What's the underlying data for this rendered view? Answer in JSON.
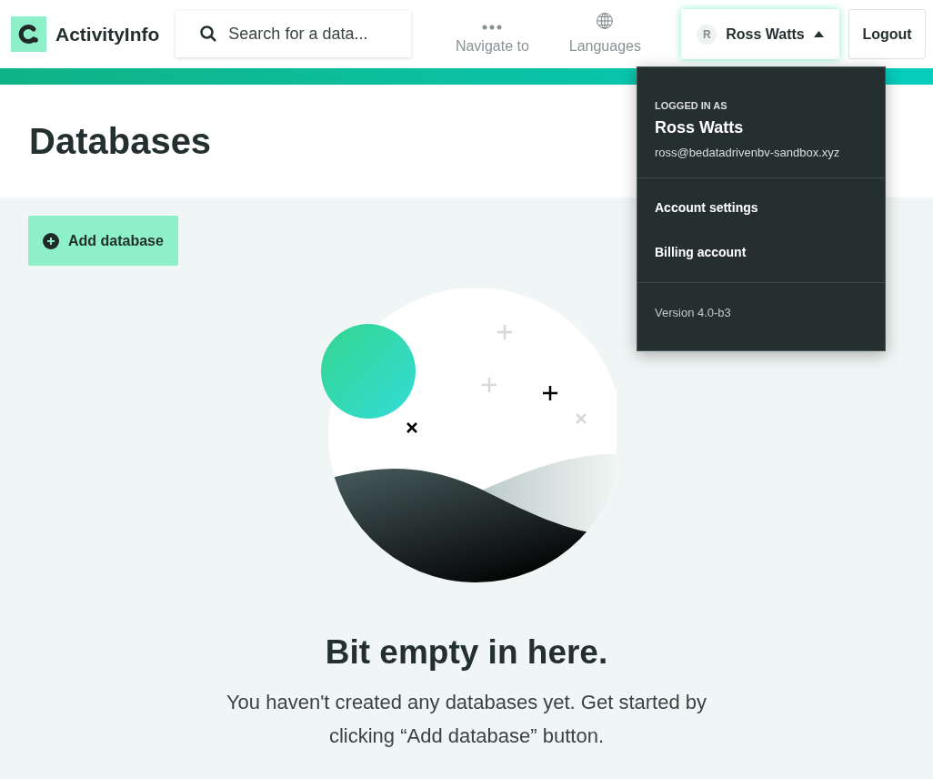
{
  "header": {
    "logo_text": "ActivityInfo",
    "search": {
      "placeholder": "Search for a data..."
    },
    "nav": [
      {
        "label": "Navigate to",
        "kind": "dots"
      },
      {
        "label": "Languages",
        "kind": "globe"
      }
    ],
    "user_button": {
      "initial": "R",
      "name": "Ross Watts",
      "expanded": true
    },
    "logout": "Logout"
  },
  "user_menu": {
    "caption": "LOGGED IN AS",
    "name": "Ross Watts",
    "email": "ross@bedatadrivenbv-sandbox.xyz",
    "items": [
      "Account settings",
      "Billing account"
    ],
    "version": "Version 4.0-b3"
  },
  "page": {
    "title": "Databases",
    "add_button": "Add database"
  },
  "empty_state": {
    "heading": "Bit empty in here.",
    "message": "You haven't created any databases yet. Get started by clicking “Add database” button."
  }
}
